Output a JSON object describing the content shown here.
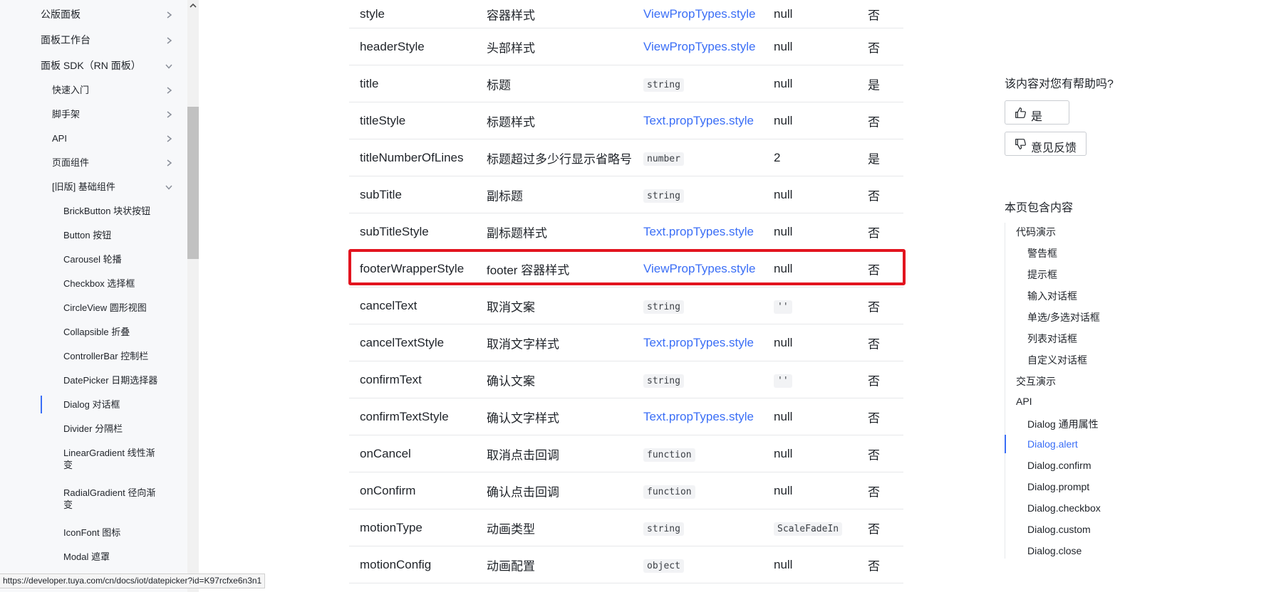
{
  "sidebar": {
    "items": [
      {
        "label": "公版面板",
        "level": 1,
        "chevron": "right"
      },
      {
        "label": "面板工作台",
        "level": 1,
        "chevron": "right"
      },
      {
        "label": "面板 SDK（RN 面板）",
        "level": 1,
        "chevron": "down"
      },
      {
        "label": "快速入门",
        "level": 2,
        "chevron": "right"
      },
      {
        "label": "脚手架",
        "level": 2,
        "chevron": "right"
      },
      {
        "label": "API",
        "level": 2,
        "chevron": "right"
      },
      {
        "label": "页面组件",
        "level": 2,
        "chevron": "right"
      },
      {
        "label": "[旧版] 基础组件",
        "level": 2,
        "chevron": "down"
      },
      {
        "label": "BrickButton 块状按钮",
        "level": 3
      },
      {
        "label": "Button 按钮",
        "level": 3
      },
      {
        "label": "Carousel 轮播",
        "level": 3
      },
      {
        "label": "Checkbox 选择框",
        "level": 3
      },
      {
        "label": "CircleView 圆形视图",
        "level": 3
      },
      {
        "label": "Collapsible 折叠",
        "level": 3
      },
      {
        "label": "ControllerBar 控制栏",
        "level": 3
      },
      {
        "label": "DatePicker 日期选择器",
        "level": 3
      },
      {
        "label": "Dialog 对话框",
        "level": 3,
        "active": true
      },
      {
        "label": "Divider 分隔栏",
        "level": 3
      },
      {
        "label": "LinearGradient 线性渐变",
        "level": 3
      },
      {
        "label": "RadialGradient 径向渐变",
        "level": 3
      },
      {
        "label": "IconFont 图标",
        "level": 3
      },
      {
        "label": "Modal 遮罩",
        "level": 3
      }
    ]
  },
  "table": {
    "rows": [
      {
        "name": "style",
        "desc": "容器样式",
        "type": "ViewPropTypes.style",
        "type_kind": "link",
        "default": "null",
        "default_kind": "text",
        "required": "否"
      },
      {
        "name": "headerStyle",
        "desc": "头部样式",
        "type": "ViewPropTypes.style",
        "type_kind": "link",
        "default": "null",
        "default_kind": "text",
        "required": "否"
      },
      {
        "name": "title",
        "desc": "标题",
        "type": "string",
        "type_kind": "code",
        "default": "null",
        "default_kind": "text",
        "required": "是"
      },
      {
        "name": "titleStyle",
        "desc": "标题样式",
        "type": "Text.propTypes.style",
        "type_kind": "link",
        "default": "null",
        "default_kind": "text",
        "required": "否"
      },
      {
        "name": "titleNumberOfLines",
        "desc": "标题超过多少行显示省略号",
        "type": "number",
        "type_kind": "code",
        "default": "2",
        "default_kind": "text",
        "required": "是"
      },
      {
        "name": "subTitle",
        "desc": "副标题",
        "type": "string",
        "type_kind": "code",
        "default": "null",
        "default_kind": "text",
        "required": "否"
      },
      {
        "name": "subTitleStyle",
        "desc": "副标题样式",
        "type": "Text.propTypes.style",
        "type_kind": "link",
        "default": "null",
        "default_kind": "text",
        "required": "否"
      },
      {
        "name": "footerWrapperStyle",
        "desc": "footer 容器样式",
        "type": "ViewPropTypes.style",
        "type_kind": "link",
        "default": "null",
        "default_kind": "text",
        "required": "否"
      },
      {
        "name": "cancelText",
        "desc": "取消文案",
        "type": "string",
        "type_kind": "code",
        "default": "''",
        "default_kind": "code",
        "required": "否"
      },
      {
        "name": "cancelTextStyle",
        "desc": "取消文字样式",
        "type": "Text.propTypes.style",
        "type_kind": "link",
        "default": "null",
        "default_kind": "text",
        "required": "否"
      },
      {
        "name": "confirmText",
        "desc": "确认文案",
        "type": "string",
        "type_kind": "code",
        "default": "''",
        "default_kind": "code",
        "required": "否"
      },
      {
        "name": "confirmTextStyle",
        "desc": "确认文字样式",
        "type": "Text.propTypes.style",
        "type_kind": "link",
        "default": "null",
        "default_kind": "text",
        "required": "否"
      },
      {
        "name": "onCancel",
        "desc": "取消点击回调",
        "type": "function",
        "type_kind": "code",
        "default": "null",
        "default_kind": "text",
        "required": "否"
      },
      {
        "name": "onConfirm",
        "desc": "确认点击回调",
        "type": "function",
        "type_kind": "code",
        "default": "null",
        "default_kind": "text",
        "required": "否"
      },
      {
        "name": "motionType",
        "desc": "动画类型",
        "type": "string",
        "type_kind": "code",
        "default": "ScaleFadeIn",
        "default_kind": "code",
        "required": "否"
      },
      {
        "name": "motionConfig",
        "desc": "动画配置",
        "type": "object",
        "type_kind": "code",
        "default": "null",
        "default_kind": "text",
        "required": "否"
      }
    ]
  },
  "feedback": {
    "question": "该内容对您有帮助吗?",
    "yes_label": "是",
    "no_label": "意见反馈"
  },
  "toc": {
    "title": "本页包含内容",
    "items": [
      {
        "label": "代码演示",
        "level": 1
      },
      {
        "label": "警告框",
        "level": 2
      },
      {
        "label": "提示框",
        "level": 2
      },
      {
        "label": "输入对话框",
        "level": 2
      },
      {
        "label": "单选/多选对话框",
        "level": 2
      },
      {
        "label": "列表对话框",
        "level": 2
      },
      {
        "label": "自定义对话框",
        "level": 2
      },
      {
        "label": "交互演示",
        "level": 1
      },
      {
        "label": "API",
        "level": 1
      },
      {
        "label": "Dialog 通用属性",
        "level": 2
      },
      {
        "label": "Dialog.alert",
        "level": 2,
        "active": true
      },
      {
        "label": "Dialog.confirm",
        "level": 2
      },
      {
        "label": "Dialog.prompt",
        "level": 2
      },
      {
        "label": "Dialog.checkbox",
        "level": 2
      },
      {
        "label": "Dialog.custom",
        "level": 2
      },
      {
        "label": "Dialog.close",
        "level": 2
      }
    ]
  },
  "status_bar": {
    "url": "https://developer.tuya.com/cn/docs/iot/datepicker?id=K97rcfxe6n3n1"
  },
  "colors": {
    "link": "#3a6ef6",
    "highlight_border": "#e2141f",
    "sidebar_bg": "#f7f8fa"
  }
}
